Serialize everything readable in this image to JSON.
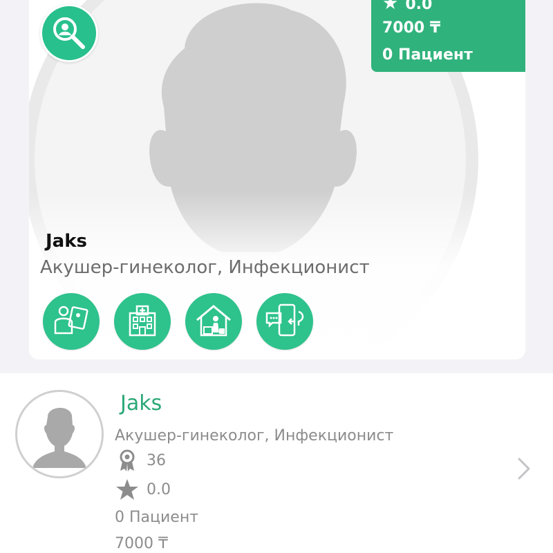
{
  "profile": {
    "name": "Jaks",
    "specialty": "Акушер-гинеколог, Инфекционист",
    "stats": {
      "rating": "0.0",
      "price": "7000 ₸",
      "patients": "0 Пациент"
    },
    "services": [
      {
        "icon": "doctor-consultation-icon"
      },
      {
        "icon": "hospital-icon"
      },
      {
        "icon": "home-visit-icon"
      },
      {
        "icon": "online-chat-icon"
      }
    ]
  },
  "list_item": {
    "name": "Jaks",
    "specialty": "Акушер-гинеколог, Инфекционист",
    "experience": "36",
    "rating": "0.0",
    "patients": "0 Пациент",
    "price": "7000 ₸"
  },
  "colors": {
    "accent": "#30b27c",
    "service_green": "#2ec28c",
    "name_green": "#2aa876",
    "muted_text": "#8c8c8c"
  }
}
